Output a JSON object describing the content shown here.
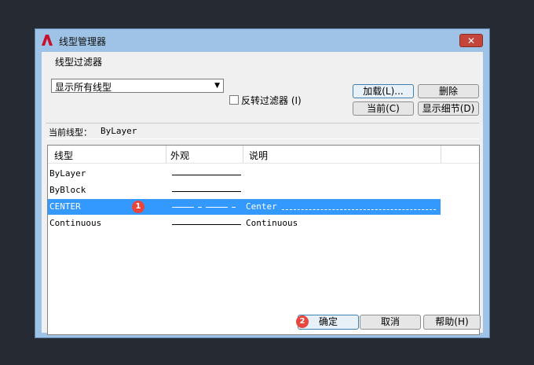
{
  "dialog": {
    "title": "线型管理器",
    "close_icon": "close-icon",
    "app_icon": "autocad-a-icon"
  },
  "filter": {
    "group_label": "线型过滤器",
    "selected": "显示所有线型",
    "invert_label": "反转过滤器 (I)",
    "invert_checked": false
  },
  "buttons": {
    "load": "加载(L)...",
    "delete": "删除",
    "current": "当前(C)",
    "details": "显示细节(D)",
    "ok": "确定",
    "cancel": "取消",
    "help": "帮助(H)"
  },
  "current_linetype": {
    "label": "当前线型：",
    "value": "ByLayer"
  },
  "table": {
    "columns": [
      "线型",
      "外观",
      "说明"
    ],
    "rows": [
      {
        "name": "ByLayer",
        "appearance": "solid",
        "description": ""
      },
      {
        "name": "ByBlock",
        "appearance": "solid",
        "description": ""
      },
      {
        "name": "CENTER",
        "appearance": "center",
        "description": "Center",
        "selected": true
      },
      {
        "name": "Continuous",
        "appearance": "solid",
        "description": "Continuous"
      }
    ]
  },
  "annotations": {
    "step1": "1",
    "step2": "2"
  },
  "colors": {
    "selection": "#3399ff",
    "badge": "#e8453c",
    "title_bar": "#9fc3e6"
  }
}
